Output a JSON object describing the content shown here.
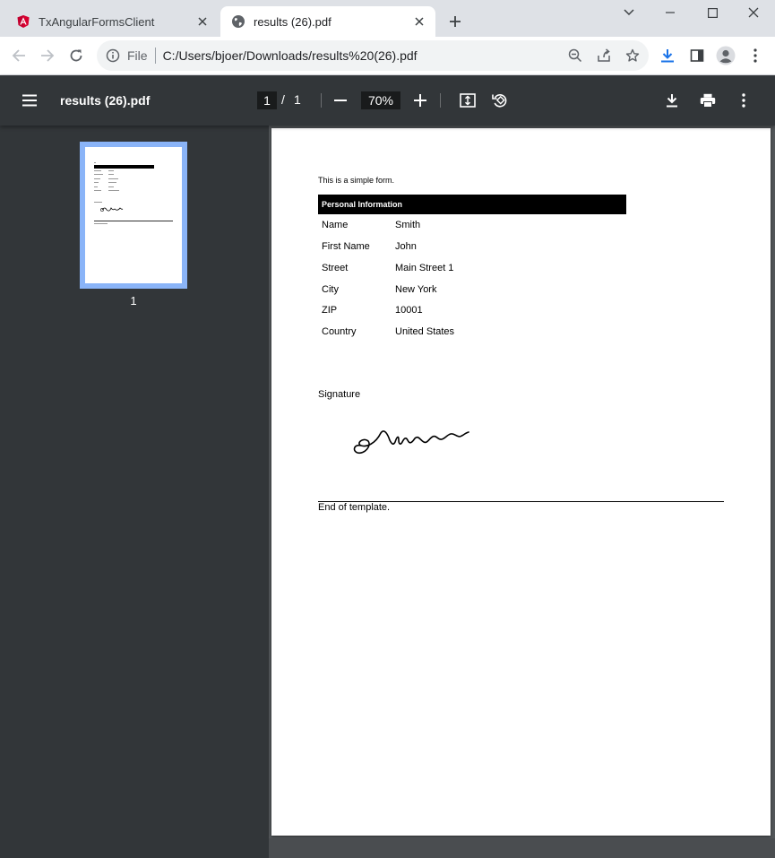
{
  "tabs": [
    {
      "title": "TxAngularFormsClient",
      "icon": "angular-logo-icon",
      "active": false
    },
    {
      "title": "results (26).pdf",
      "icon": "globe-icon",
      "active": true
    }
  ],
  "address_bar": {
    "scheme_label": "File",
    "url": "C:/Users/bjoer/Downloads/results%20(26).pdf"
  },
  "pdf_viewer": {
    "title": "results (26).pdf",
    "current_page": "1",
    "page_separator": "/",
    "total_pages": "1",
    "zoom": "70%",
    "thumbnail_label": "1"
  },
  "document": {
    "intro": "This is a simple form.",
    "section_title": "Personal Information",
    "fields": [
      {
        "label": "Name",
        "value": "Smith"
      },
      {
        "label": "First Name",
        "value": "John"
      },
      {
        "label": "Street",
        "value": "Main Street 1"
      },
      {
        "label": "City",
        "value": "New York"
      },
      {
        "label": "ZIP",
        "value": "10001"
      },
      {
        "label": "Country",
        "value": "United States"
      }
    ],
    "signature_label": "Signature",
    "end_text": "End of template."
  },
  "colors": {
    "viewer_toolbar": "#323639",
    "viewer_background": "#525659",
    "thumbnail_highlight": "#8ab4f8",
    "download_accent": "#1a73e8",
    "angular_logo": "#c3002f"
  }
}
